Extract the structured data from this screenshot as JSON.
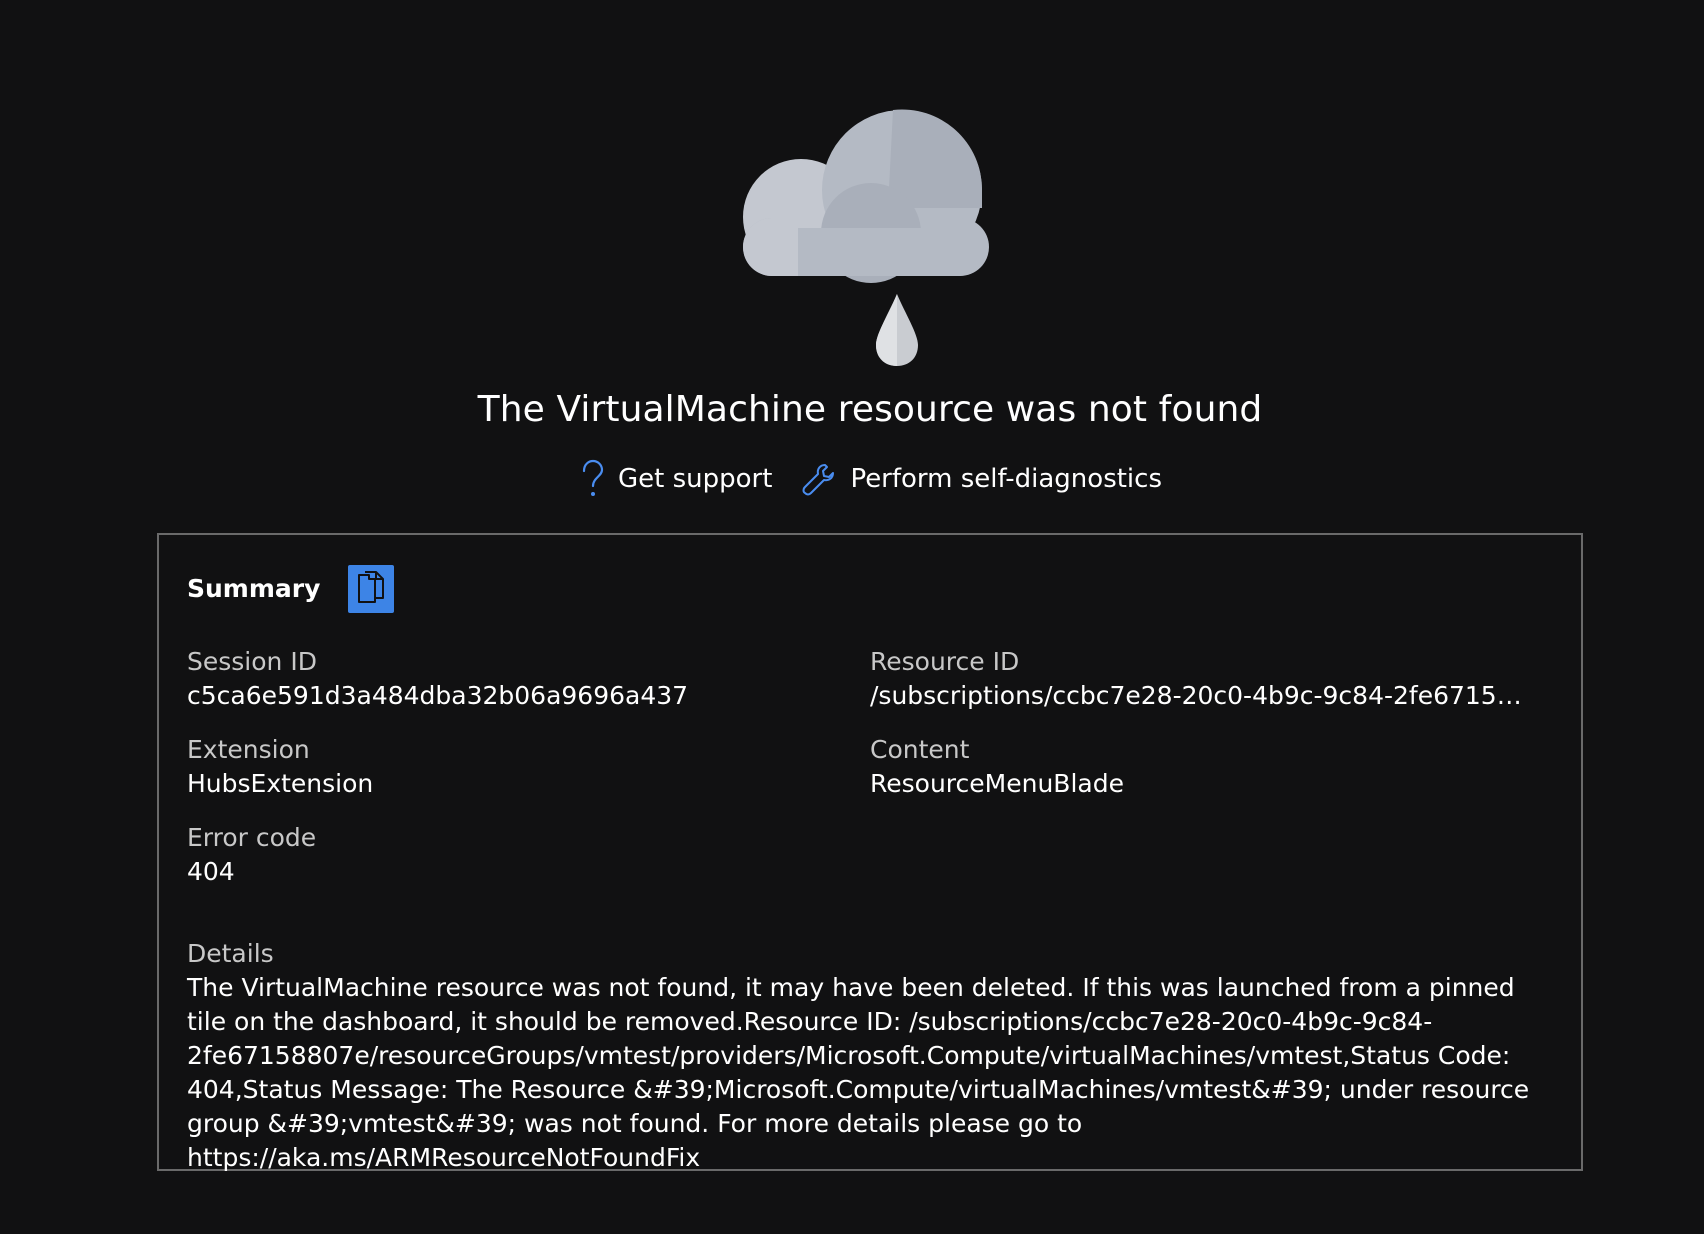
{
  "error": {
    "title": "The VirtualMachine resource was not found"
  },
  "actions": {
    "get_support": "Get support",
    "self_diagnostics": "Perform self-diagnostics"
  },
  "summary": {
    "title": "Summary",
    "fields": {
      "session_id": {
        "label": "Session ID",
        "value": "c5ca6e591d3a484dba32b06a9696a437"
      },
      "resource_id": {
        "label": "Resource ID",
        "value": "/subscriptions/ccbc7e28-20c0-4b9c-9c84-2fe67158807..."
      },
      "extension": {
        "label": "Extension",
        "value": "HubsExtension"
      },
      "content": {
        "label": "Content",
        "value": "ResourceMenuBlade"
      },
      "error_code": {
        "label": "Error code",
        "value": "404"
      }
    },
    "details": {
      "label": "Details",
      "value": "The VirtualMachine resource was not found, it may have been deleted. If this was launched from a pinned tile on the dashboard, it should be removed.Resource ID: /subscriptions/ccbc7e28-20c0-4b9c-9c84-2fe67158807e/resourceGroups/vmtest/providers/Microsoft.Compute/virtualMachines/vmtest,Status Code: 404,Status Message: The Resource &#39;Microsoft.Compute/virtualMachines/vmtest&#39; under resource group &#39;vmtest&#39; was not found. For more details please go to https://aka.ms/ARMResourceNotFoundFix"
    }
  },
  "icons": {
    "illustration": "cloud-raindrop-icon",
    "support": "question-mark-icon",
    "diagnostics": "wrench-icon",
    "copy": "copy-icon"
  },
  "colors": {
    "background": "#111112",
    "accent": "#3d84e6",
    "border": "#6a6a6a"
  }
}
